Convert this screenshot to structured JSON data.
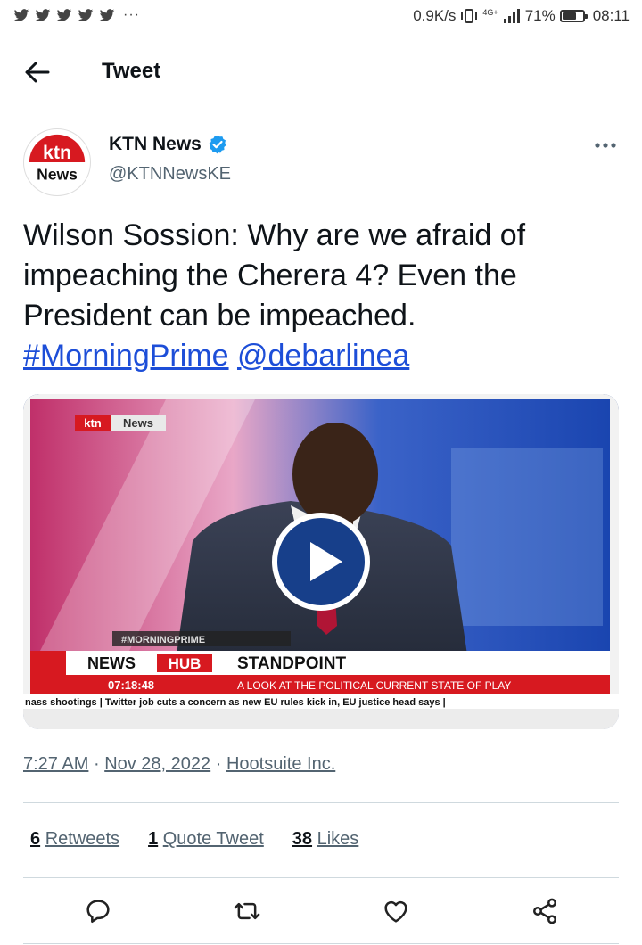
{
  "status_bar": {
    "notifications": [
      "twitter-icon",
      "twitter-icon",
      "twitter-icon",
      "twitter-icon",
      "twitter-icon"
    ],
    "more": "···",
    "speed": "0.9K/s",
    "network": "4G+",
    "battery_percent": "71%",
    "battery_level": 0.71,
    "time": "08:11"
  },
  "header": {
    "title": "Tweet"
  },
  "author": {
    "avatar_top": "ktn",
    "avatar_bottom": "News",
    "name": "KTN News",
    "handle": "@KTNNewsKE"
  },
  "tweet": {
    "text": "Wilson Sossion: Why are we afraid of impeaching the Cherera 4? Even the President can be impeached.",
    "hashtag": "#MorningPrime",
    "mention": "@debarlinea"
  },
  "video": {
    "logo_left": "ktn",
    "logo_right": "News",
    "tag": "#MORNINGPRIME",
    "ticker_brand1": "NEWS",
    "ticker_brand2": "HUB",
    "program": "STANDPOINT",
    "clock": "07:18:48",
    "strap": "A LOOK AT THE POLITICAL CURRENT STATE OF PLAY",
    "crawl": "nass shootings | Twitter job cuts a concern as new EU rules kick in, EU justice head says |"
  },
  "meta": {
    "time": "7:27 AM",
    "date": "Nov 28, 2022",
    "source": "Hootsuite Inc."
  },
  "stats": {
    "retweets": "6",
    "retweets_label": "Retweets",
    "quotes": "1",
    "quotes_label": "Quote Tweet",
    "likes": "38",
    "likes_label": "Likes"
  },
  "colors": {
    "link": "#1d4ed8",
    "verified": "#1d9bf0",
    "ktn_red": "#d71920",
    "play_blue": "#173f8a"
  }
}
